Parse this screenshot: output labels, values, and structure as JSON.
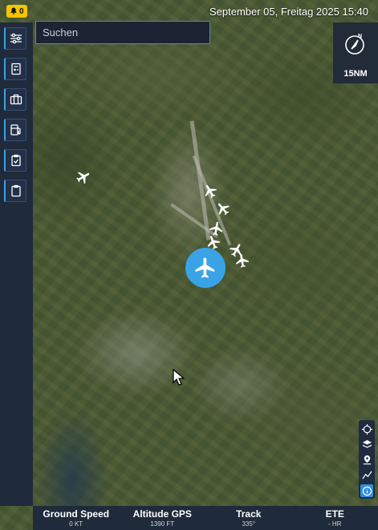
{
  "status_bar": {
    "notification_count": "0",
    "datetime": "September 05, Freitag 2025 15:40"
  },
  "search": {
    "placeholder": "Suchen",
    "value": ""
  },
  "compass_panel": {
    "range": "15NM"
  },
  "sidebar": {
    "items": [
      {
        "icon": "sliders-icon"
      },
      {
        "icon": "checklist-calc-icon"
      },
      {
        "icon": "briefcase-icon"
      },
      {
        "icon": "fuel-icon"
      },
      {
        "icon": "clipboard-check-icon"
      },
      {
        "icon": "clipboard-icon"
      }
    ]
  },
  "map_tools": [
    "crosshair-icon",
    "layers-icon",
    "pin-icon",
    "route-icon",
    "info-icon"
  ],
  "bottom_bar": {
    "ground_speed": {
      "label": "Ground Speed",
      "value": "0 KT"
    },
    "altitude": {
      "label": "Altitude GPS",
      "value": "1390 FT"
    },
    "track": {
      "label": "Track",
      "value": "335°"
    },
    "ete": {
      "label": "ETE",
      "value": "- HR"
    }
  },
  "colors": {
    "accent": "#3aa3e6",
    "notification": "#f5c400",
    "panel": "#1f2a3b"
  }
}
